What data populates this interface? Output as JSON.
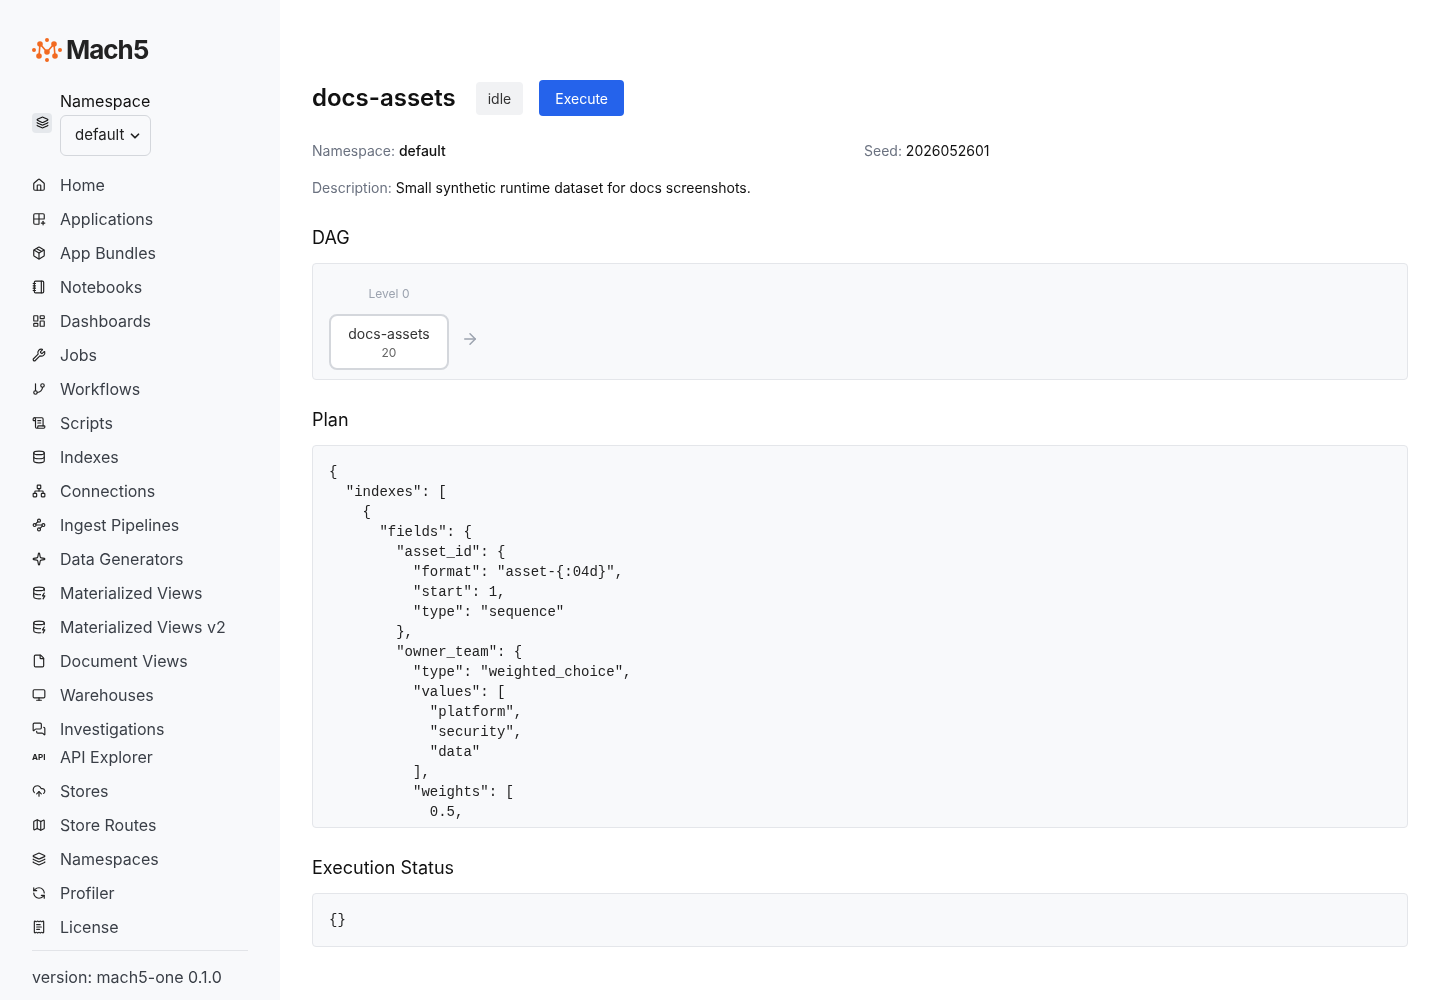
{
  "sidebar": {
    "logo": "Mach5",
    "namespace": {
      "label": "Namespace",
      "value": "default"
    },
    "items": [
      {
        "label": "Home"
      },
      {
        "label": "Applications"
      },
      {
        "label": "App Bundles"
      },
      {
        "label": "Notebooks"
      },
      {
        "label": "Dashboards"
      },
      {
        "label": "Jobs"
      },
      {
        "label": "Workflows"
      },
      {
        "label": "Scripts"
      },
      {
        "label": "Indexes"
      },
      {
        "label": "Connections"
      },
      {
        "label": "Ingest Pipelines"
      },
      {
        "label": "Data Generators"
      },
      {
        "label": "Materialized Views"
      },
      {
        "label": "Materialized Views v2"
      },
      {
        "label": "Document Views"
      },
      {
        "label": "Warehouses"
      },
      {
        "label": "Investigations"
      },
      {
        "label": "API Explorer",
        "icon_text": "API"
      },
      {
        "label": "Stores"
      },
      {
        "label": "Store Routes"
      },
      {
        "label": "Namespaces"
      },
      {
        "label": "Profiler"
      },
      {
        "label": "License"
      }
    ],
    "version": "version: mach5-one 0.1.0"
  },
  "header": {
    "title": "docs-assets",
    "status": "idle",
    "button": "Execute"
  },
  "details": [
    {
      "label": "Namespace:",
      "value": "default",
      "bold": true
    },
    {
      "label": "Seed:",
      "value": "2026052601",
      "bold": false
    }
  ],
  "description": {
    "label": "Description:",
    "value": "Small synthetic runtime dataset for docs screenshots."
  },
  "dag": {
    "title": "DAG",
    "level": "Level 0",
    "node": {
      "name": "docs-assets",
      "count": "20"
    }
  },
  "plan": {
    "title": "Plan",
    "lines": [
      "{",
      "  \"indexes\": [",
      "    {",
      "      \"fields\": {",
      "        \"asset_id\": {",
      "          \"format\": \"asset-{:04d}\",",
      "          \"start\": 1,",
      "          \"type\": \"sequence\"",
      "        },",
      "        \"owner_team\": {",
      "          \"type\": \"weighted_choice\",",
      "          \"values\": [",
      "            \"platform\",",
      "            \"security\",",
      "            \"data\"",
      "          ],",
      "          \"weights\": [",
      "            0.5,"
    ]
  },
  "execution_status": {
    "title": "Execution Status",
    "value": "{}"
  }
}
